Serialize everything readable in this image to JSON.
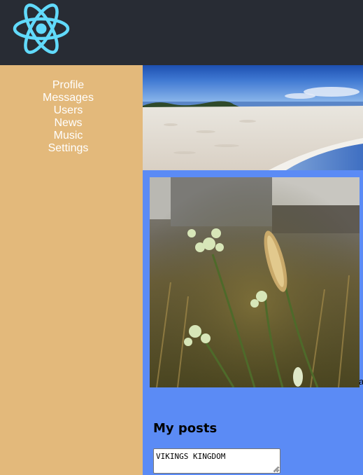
{
  "header": {
    "logo_icon": "react-atom-logo",
    "logo_color": "#61dafb",
    "background": "#282c34"
  },
  "sidebar": {
    "background": "#e3b97b",
    "items": [
      {
        "label": "Profile"
      },
      {
        "label": "Messages"
      },
      {
        "label": "Users"
      },
      {
        "label": "News"
      },
      {
        "label": "Music"
      },
      {
        "label": "Settings"
      }
    ]
  },
  "content": {
    "background": "#5b8bf5",
    "banner_image": "beach-photo",
    "avatar_image": "wildflowers-photo",
    "avatar_alt_partial": "a",
    "posts": {
      "title": "My posts",
      "input_value": "VIKINGS KINGDOM"
    }
  }
}
